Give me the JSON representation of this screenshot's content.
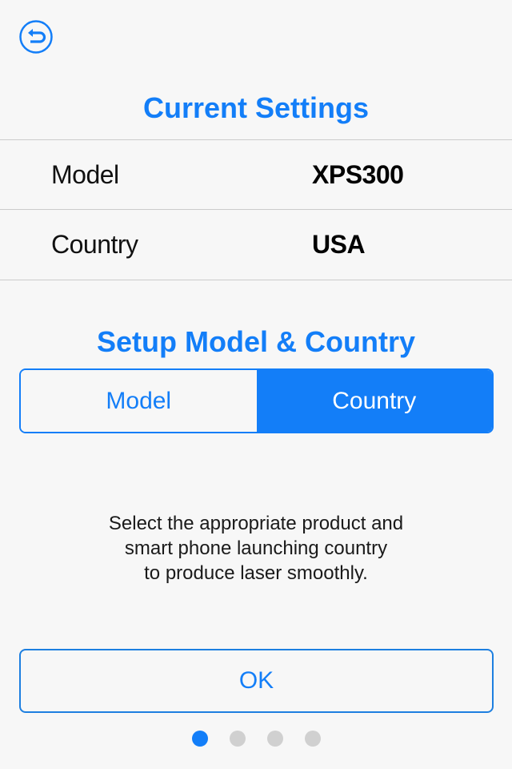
{
  "header": {
    "back_icon": "back-undo-arrow-icon",
    "title": "Current Settings"
  },
  "current_settings": {
    "rows": [
      {
        "label": "Model",
        "value": "XPS300"
      },
      {
        "label": "Country",
        "value": "USA"
      }
    ]
  },
  "setup": {
    "title": "Setup Model & Country",
    "segments": [
      {
        "label": "Model",
        "selected": false
      },
      {
        "label": "Country",
        "selected": true
      }
    ],
    "description_lines": [
      "Select the appropriate product and",
      "smart phone launching country",
      "to produce laser smoothly."
    ]
  },
  "ok_button": {
    "label": "OK"
  },
  "pager": {
    "total": 4,
    "current": 1
  },
  "colors": {
    "accent": "#137ef8",
    "background": "#f7f7f7",
    "divider": "#cccccc",
    "dot_inactive": "#d0d0d0"
  }
}
